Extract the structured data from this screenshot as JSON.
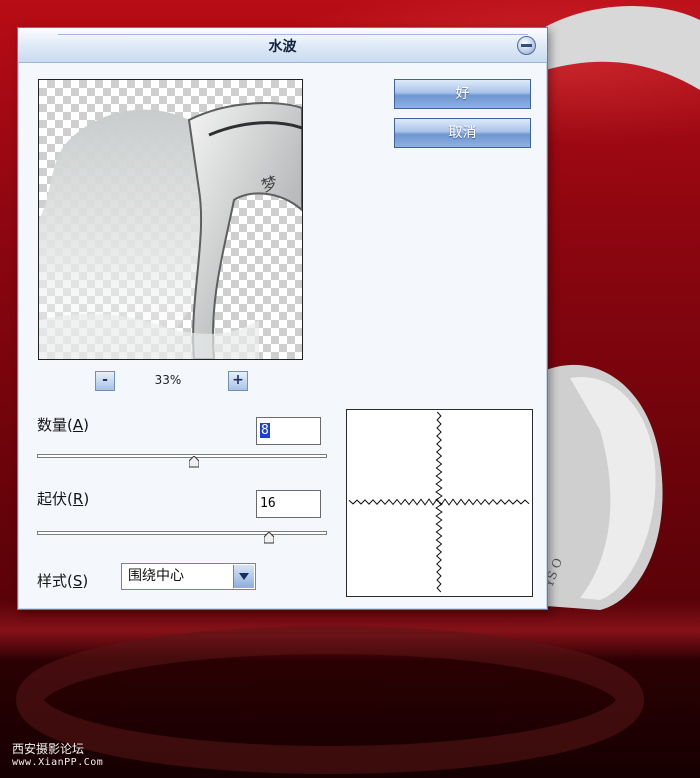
{
  "dialog": {
    "title": "水波",
    "ok_label": "好",
    "cancel_label": "取消",
    "zoom": {
      "out_symbol": "-",
      "level": "33%",
      "in_symbol": "+"
    },
    "amount": {
      "label_prefix": "数量",
      "hotkey": "A",
      "value": "8",
      "slider_fraction": 0.54
    },
    "ridges": {
      "label_prefix": "起伏",
      "hotkey": "R",
      "value": "16",
      "slider_fraction": 0.8
    },
    "style": {
      "label_prefix": "样式",
      "hotkey": "S",
      "selected": "围绕中心"
    }
  },
  "watermark": {
    "line1": "西安摄影论坛",
    "line2": "www.XianPP.Com"
  },
  "colors": {
    "background_red": "#8e0610",
    "dialog_bg": "#f4f8fd",
    "button_blue": "#6f96d2",
    "titlebar_blue": "#c9daf0"
  },
  "icons": {
    "close": "minimize-circle-icon",
    "dropdown": "chevron-down-icon"
  }
}
